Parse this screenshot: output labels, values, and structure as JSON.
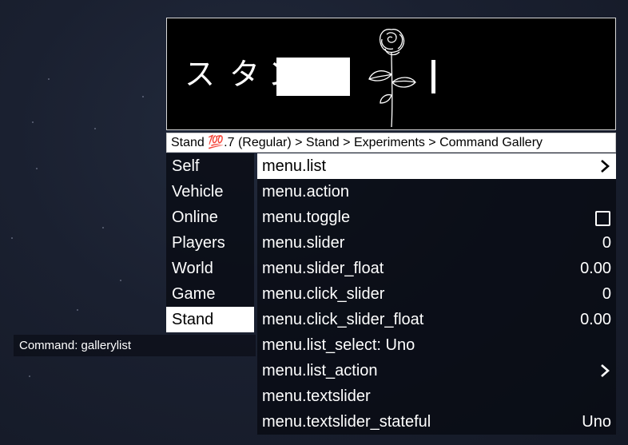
{
  "header": {
    "kana": [
      "ス",
      "タ",
      "ン"
    ],
    "logo_icon": "rose-icon"
  },
  "breadcrumb": "Stand 💯.7 (Regular) > Stand > Experiments > Command Gallery",
  "sidebar": {
    "items": [
      {
        "label": "Self"
      },
      {
        "label": "Vehicle"
      },
      {
        "label": "Online"
      },
      {
        "label": "Players"
      },
      {
        "label": "World"
      },
      {
        "label": "Game"
      },
      {
        "label": "Stand",
        "active": true
      }
    ]
  },
  "list": {
    "items": [
      {
        "label": "menu.list",
        "indicator": "chevron-right-icon",
        "active": true
      },
      {
        "label": "menu.action"
      },
      {
        "label": "menu.toggle",
        "indicator": "checkbox-icon"
      },
      {
        "label": "menu.slider",
        "value": "0"
      },
      {
        "label": "menu.slider_float",
        "value": "0.00"
      },
      {
        "label": "menu.click_slider",
        "value": "0"
      },
      {
        "label": "menu.click_slider_float",
        "value": "0.00"
      },
      {
        "label": "menu.list_select: Uno"
      },
      {
        "label": "menu.list_action",
        "indicator": "chevron-right-icon"
      },
      {
        "label": "menu.textslider"
      },
      {
        "label": "menu.textslider_stateful",
        "value": "Uno"
      }
    ]
  },
  "command": "Command: gallerylist",
  "colors": {
    "panel": "#0a0c14",
    "active": "#ffffff",
    "header_bg": "#000000"
  }
}
